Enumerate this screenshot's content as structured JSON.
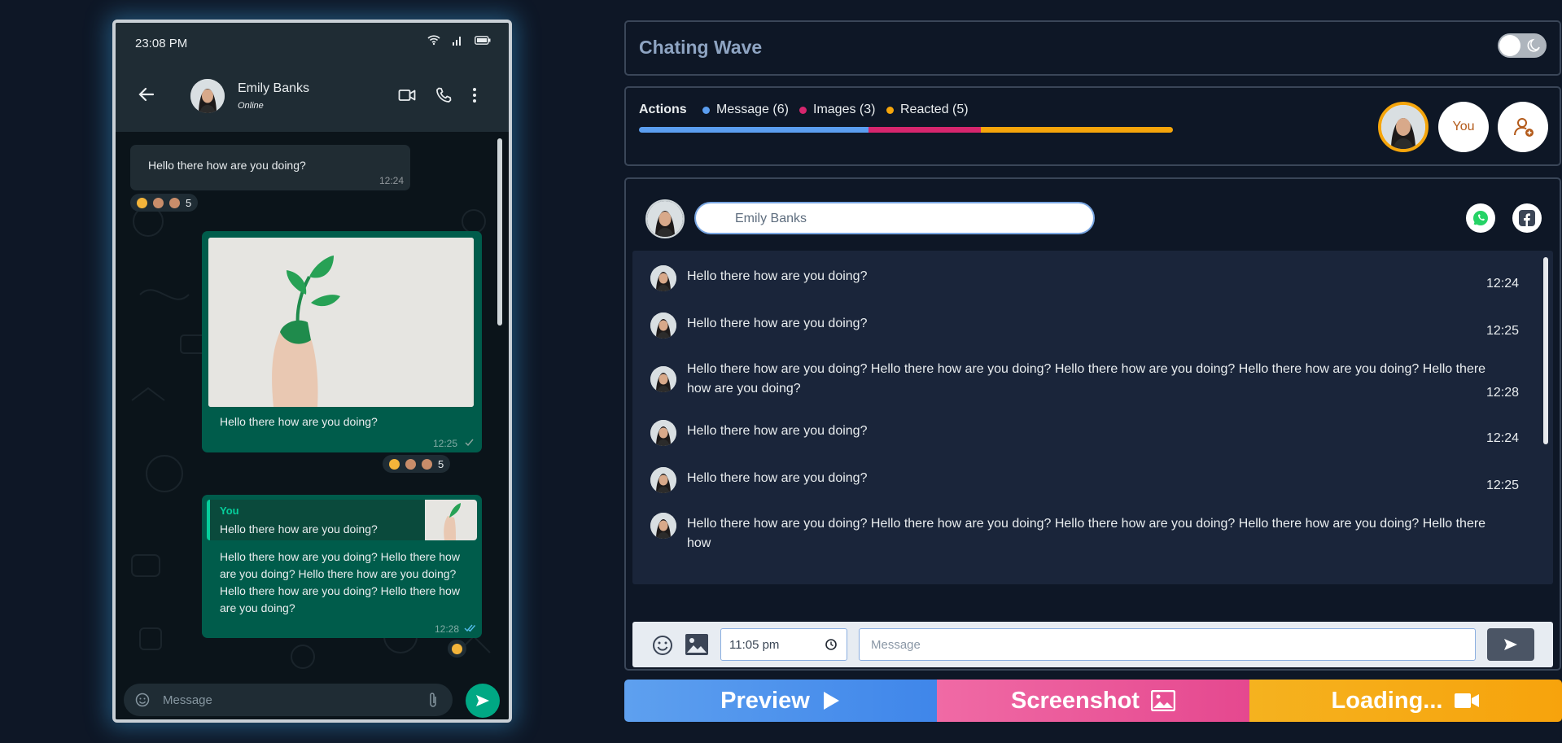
{
  "phone": {
    "status_time": "23:08 PM",
    "contact_name": "Emily Banks",
    "contact_status": "Online",
    "messages": [
      {
        "text": "Hello there how are you doing?",
        "time": "12:24",
        "reaction_count": "5"
      },
      {
        "text": "Hello there how are you doing?",
        "time": "12:25",
        "reaction_count": "5"
      },
      {
        "reply_author": "You",
        "reply_text": "Hello there how are you doing?",
        "text": "Hello there how are you doing? Hello there how are you doing? Hello there how are you doing? Hello there how are you doing? Hello there how are you doing?",
        "time": "12:28"
      }
    ],
    "input_placeholder": "Message"
  },
  "app": {
    "title": "Chating Wave",
    "actions_label": "Actions",
    "legend": [
      {
        "label": "Message (6)",
        "color": "#5b9ef0"
      },
      {
        "label": "Images (3)",
        "color": "#d6266e"
      },
      {
        "label": "Reacted  (5)",
        "color": "#f5a50b"
      }
    ],
    "progress": [
      {
        "name": "Message",
        "fraction": 0.43,
        "color": "#5b9ef0"
      },
      {
        "name": "Images",
        "fraction": 0.21,
        "color": "#d6266e"
      },
      {
        "name": "Reacted",
        "fraction": 0.36,
        "color": "#f5a50b"
      }
    ],
    "you_label": "You",
    "name_input_value": "Emily Banks",
    "chat_messages": [
      {
        "text": "Hello there how are you doing?",
        "time": "12:24"
      },
      {
        "text": "Hello there how are you doing?",
        "time": "12:25"
      },
      {
        "text": "Hello there how are you doing? Hello there how are you doing? Hello there how are you doing? Hello there how are you doing? Hello there how are you doing?",
        "time": "12:28"
      },
      {
        "text": "Hello there how are you doing?",
        "time": "12:24"
      },
      {
        "text": "Hello there how are you doing?",
        "time": "12:25"
      },
      {
        "text": "Hello there how are you doing? Hello there how are you doing? Hello there how are you doing? Hello there how are you doing? Hello there how",
        "time": ""
      }
    ],
    "time_value": "11:05 pm",
    "message_placeholder": "Message",
    "buttons": {
      "preview": "Preview",
      "screenshot": "Screenshot",
      "loading": "Loading..."
    }
  }
}
